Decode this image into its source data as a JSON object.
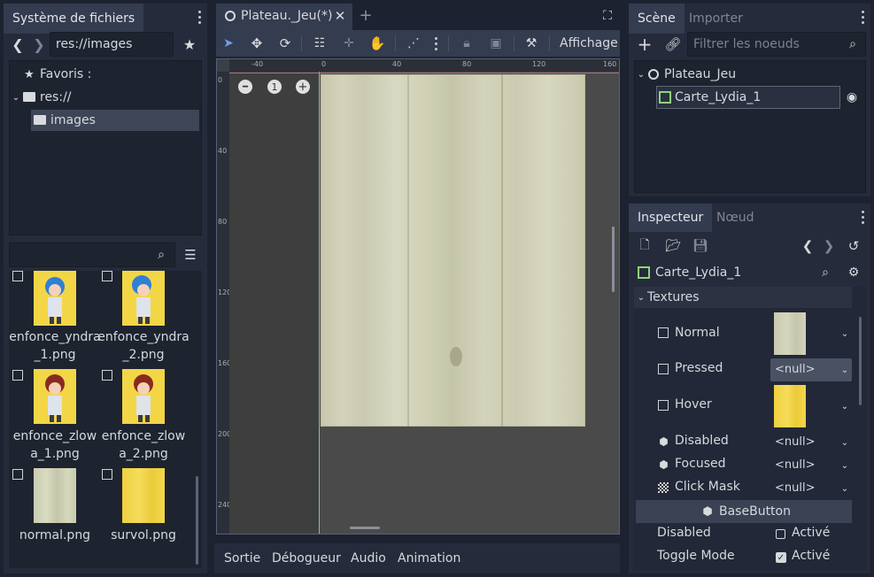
{
  "filesystem": {
    "tab_title": "Système de fichiers",
    "path": "res://images",
    "tree": {
      "favorites": "Favoris :",
      "root": "res://",
      "folder": "images"
    },
    "files": [
      {
        "name_line1": "enfonce_yndra",
        "name_line2": "_1.png"
      },
      {
        "name_line1": "enfonce_yndra",
        "name_line2": "_2.png"
      },
      {
        "name_line1": "enfonce_zlow",
        "name_line2": "a_1.png"
      },
      {
        "name_line1": "enfonce_zlow",
        "name_line2": "a_2.png"
      },
      {
        "name_line1": "normal.png",
        "name_line2": ""
      },
      {
        "name_line1": "survol.png",
        "name_line2": ""
      }
    ]
  },
  "editor": {
    "tab_title": "Plateau._Jeu(*)",
    "view_menu": "Affichage",
    "zoom_reset": "1",
    "ruler_h": [
      "-40",
      "0",
      "40",
      "80",
      "120",
      "160"
    ],
    "ruler_v": [
      "0",
      "40",
      "80",
      "120",
      "160",
      "200",
      "240"
    ]
  },
  "bottom_panel": {
    "tabs": [
      "Sortie",
      "Débogueur",
      "Audio",
      "Animation"
    ]
  },
  "scene": {
    "tab_scene": "Scène",
    "tab_import": "Importer",
    "filter_placeholder": "Filtrer les noeuds",
    "root_node": "Plateau_Jeu",
    "child_node": "Carte_Lydia_1"
  },
  "inspector": {
    "tab_inspector": "Inspecteur",
    "tab_node": "Nœud",
    "object_name": "Carte_Lydia_1",
    "section_textures": "Textures",
    "props": [
      {
        "label": "Normal",
        "value": ""
      },
      {
        "label": "Pressed",
        "value": "<null>"
      },
      {
        "label": "Hover",
        "value": ""
      },
      {
        "label": "Disabled",
        "value": "<null>"
      },
      {
        "label": "Focused",
        "value": "<null>"
      },
      {
        "label": "Click Mask",
        "value": "<null>"
      }
    ],
    "section_basebutton": "BaseButton",
    "base_props": [
      {
        "label": "Disabled",
        "value": "Activé",
        "checked": false
      },
      {
        "label": "Toggle Mode",
        "value": "Activé",
        "checked": true
      }
    ]
  },
  "colors": {
    "accent": "#6f9ee8",
    "wood_light": "#d4d6b8",
    "wood_yellow": "#f2d646",
    "background": "#1d2230",
    "panel": "#252b3a"
  }
}
